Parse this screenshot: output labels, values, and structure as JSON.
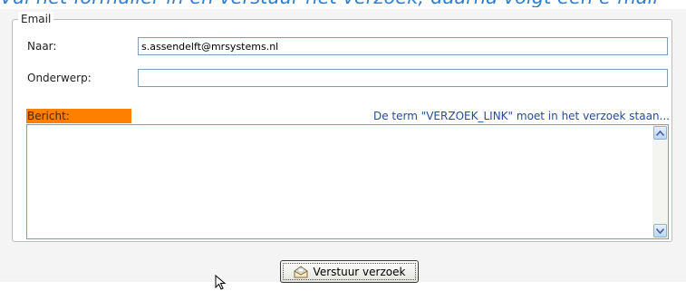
{
  "header": {
    "caption_fragment": "Vul het formulier in en verstuur het verzoek; daarna volgt een e-mail"
  },
  "email": {
    "legend": "Email",
    "to_label": "Naar:",
    "to_value": "s.assendelft@mrsystems.nl",
    "subject_label": "Onderwerp:",
    "subject_value": "",
    "message_label": "Bericht:",
    "message_hint": "De term \"VERZOEK_LINK\" moet in het verzoek staan...",
    "message_value": ""
  },
  "actions": {
    "send_label": "Verstuur verzoek"
  },
  "colors": {
    "accent_label": "#ff8000",
    "hint_text": "#234e9a",
    "field_border": "#7f9db9"
  },
  "icons": {
    "send": "envelope-icon",
    "scroll_up": "arrow-up-icon",
    "scroll_down": "arrow-down-icon",
    "pointer": "mouse-pointer-icon"
  }
}
